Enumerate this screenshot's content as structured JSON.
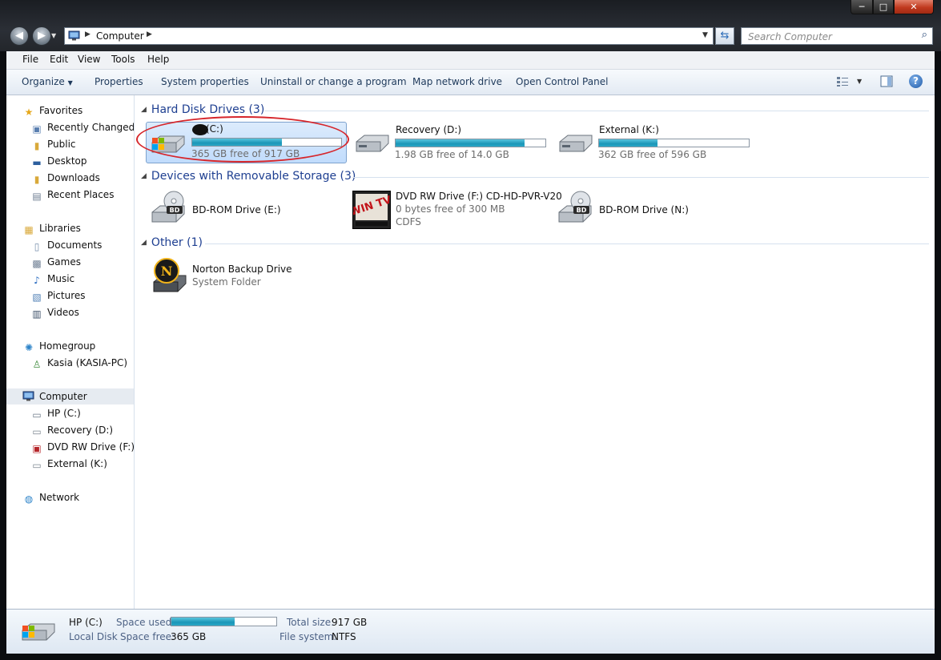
{
  "window": {
    "caption_min": "─",
    "caption_max": "□",
    "caption_close": "✕"
  },
  "address": {
    "crumb": "Computer",
    "search_placeholder": "Search Computer"
  },
  "menu": [
    "File",
    "Edit",
    "View",
    "Tools",
    "Help"
  ],
  "toolbar": {
    "organize": "Organize",
    "properties": "Properties",
    "system_properties": "System properties",
    "uninstall": "Uninstall or change a program",
    "map_drive": "Map network drive",
    "control_panel": "Open Control Panel"
  },
  "nav": {
    "favorites": "Favorites",
    "recently_changed": "Recently Changed",
    "public": "Public",
    "desktop": "Desktop",
    "downloads": "Downloads",
    "recent_places": "Recent Places",
    "libraries": "Libraries",
    "documents": "Documents",
    "games": "Games",
    "music": "Music",
    "pictures": "Pictures",
    "videos": "Videos",
    "homegroup": "Homegroup",
    "kasia": "Kasia (KASIA-PC)",
    "computer": "Computer",
    "hp_c": "HP (C:)",
    "recovery_d": "Recovery (D:)",
    "dvd_f": "DVD RW Drive (F:) C",
    "external_k": "External (K:)",
    "network": "Network"
  },
  "groups": {
    "hdd": "Hard Disk Drives (3)",
    "removable": "Devices with Removable Storage (3)",
    "other": "Other (1)"
  },
  "drives": [
    {
      "name": "(C:)",
      "free": "365 GB free of 917 GB",
      "used_fraction": 0.6
    },
    {
      "name": "Recovery (D:)",
      "free": "1.98 GB free of 14.0 GB",
      "used_fraction": 0.86
    },
    {
      "name": "External (K:)",
      "free": "362 GB free of 596 GB",
      "used_fraction": 0.39
    }
  ],
  "removable": [
    {
      "name": "BD-ROM Drive (E:)",
      "badge": "BD"
    },
    {
      "name": "DVD RW Drive (F:) CD-HD-PVR-V20",
      "free": "0 bytes free of 300 MB",
      "fs": "CDFS",
      "logo": "WIN TV"
    },
    {
      "name": "BD-ROM Drive (N:)",
      "badge": "BD"
    }
  ],
  "other": [
    {
      "name": "Norton Backup Drive",
      "sub": "System Folder",
      "logo": "N"
    }
  ],
  "details": {
    "name": "HP (C:)",
    "type": "Local Disk",
    "space_used_label": "Space used:",
    "space_free_label": "Space free:",
    "space_free": "365 GB",
    "total_size_label": "Total size:",
    "total_size": "917 GB",
    "fs_label": "File system:",
    "fs": "NTFS",
    "used_fraction": 0.6
  },
  "colors": {
    "accent": "#1e3f91",
    "bar_fill": "#1b96b8",
    "highlight": "#c1dcfc",
    "annotation": "#d6262b"
  }
}
